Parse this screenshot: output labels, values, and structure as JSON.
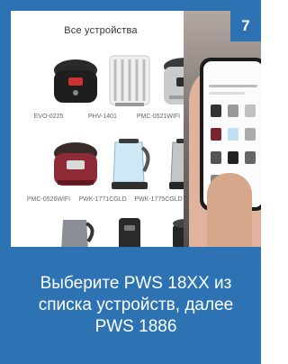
{
  "step_badge": "7",
  "catalog": {
    "title": "Все устройства",
    "devices": [
      {
        "label": "EVO-0225",
        "icon": "multicooker-black-icon"
      },
      {
        "label": "PHV-1401",
        "icon": "heater-icon"
      },
      {
        "label": "PMC-0521WIFI",
        "icon": "multicooker-steel-icon"
      },
      {
        "label": "PMC-0526WIFI",
        "icon": "multicooker-red-icon"
      },
      {
        "label": "PWK-1771CGLD",
        "icon": "kettle-glass-icon"
      },
      {
        "label": "PWK-1775CGLD",
        "icon": "kettle-steel-icon"
      },
      {
        "label": "",
        "icon": "kettle-dark-icon"
      },
      {
        "label": "",
        "icon": "humidifier-icon"
      },
      {
        "label": "",
        "icon": "appliance-dark-icon"
      }
    ]
  },
  "instruction": "Выберите PWS 18XX из списка устройств, далее PWS 1886",
  "colors": {
    "accent": "#2d73b4",
    "text_on_accent": "#ffffff"
  }
}
